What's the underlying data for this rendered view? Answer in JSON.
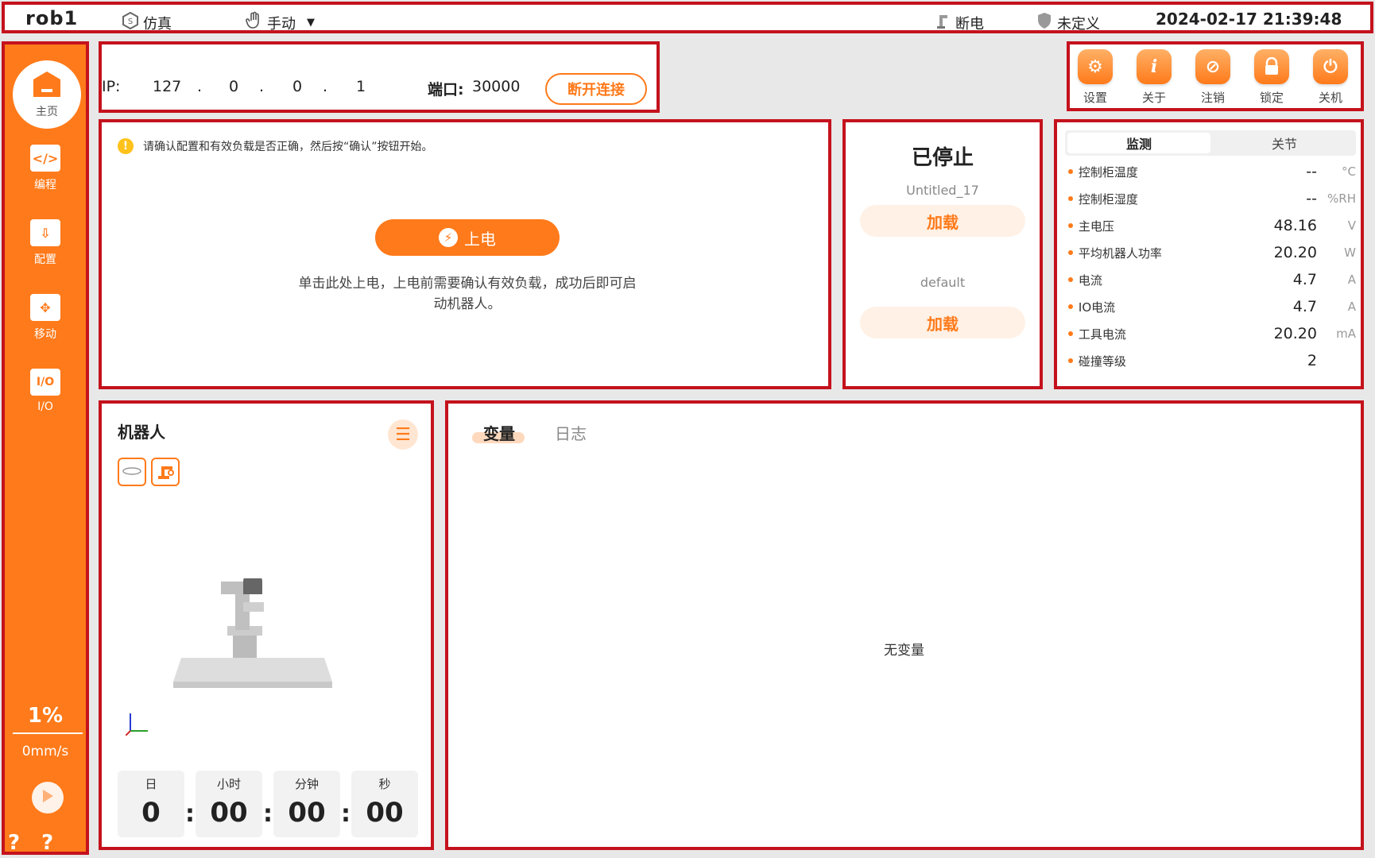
{
  "topbar": {
    "app_name": "rob1",
    "sim_label": "仿真",
    "mode_label": "手动",
    "power_status": "断电",
    "safety_status": "未定义",
    "datetime": "2024-02-17 21:39:48"
  },
  "sidebar": {
    "home_label": "主页",
    "items": [
      {
        "label": "编程",
        "icon": "code-icon"
      },
      {
        "label": "配置",
        "icon": "config-icon"
      },
      {
        "label": "移动",
        "icon": "move-icon"
      },
      {
        "label": "I/O",
        "icon": "io-icon"
      }
    ],
    "speed_percent": "1%",
    "speed_value": "0mm/s",
    "footer_text": "? ? ? ?"
  },
  "connection": {
    "ip_label": "IP:",
    "ip_parts": [
      "127",
      "0",
      "0",
      "1"
    ],
    "ip_dot": ".",
    "port_label": "端口:",
    "port_value": "30000",
    "disconnect_label": "断开连接"
  },
  "toolbar": {
    "settings": "设置",
    "about": "关于",
    "logout": "注销",
    "lock": "锁定",
    "shutdown": "关机"
  },
  "power": {
    "notice": "请确认配置和有效负载是否正确，然后按“确认”按钮开始。",
    "button_label": "上电",
    "description": "单击此处上电，上电前需要确认有效负载，成功后即可启动机器人。"
  },
  "program": {
    "state": "已停止",
    "program_name": "Untitled_17",
    "load_label_1": "加载",
    "config_name": "default",
    "load_label_2": "加载"
  },
  "monitor": {
    "tabs": [
      "监测",
      "关节"
    ],
    "rows": [
      {
        "label": "控制柜温度",
        "value": "--",
        "unit": "°C"
      },
      {
        "label": "控制柜湿度",
        "value": "--",
        "unit": "%RH"
      },
      {
        "label": "主电压",
        "value": "48.16",
        "unit": "V"
      },
      {
        "label": "平均机器人功率",
        "value": "20.20",
        "unit": "W"
      },
      {
        "label": "电流",
        "value": "4.7",
        "unit": "A"
      },
      {
        "label": "IO电流",
        "value": "4.7",
        "unit": "A"
      },
      {
        "label": "工具电流",
        "value": "20.20",
        "unit": "mA"
      },
      {
        "label": "碰撞等级",
        "value": "2",
        "unit": ""
      }
    ]
  },
  "robot": {
    "title": "机器人",
    "time_labels": [
      "日",
      "小时",
      "分钟",
      "秒"
    ],
    "time_values": [
      "0",
      "00",
      "00",
      "00"
    ],
    "separator": ":"
  },
  "variables": {
    "tab_vars": "变量",
    "tab_log": "日志",
    "empty_text": "无变量"
  },
  "colors": {
    "accent": "#ff7a1a",
    "frame": "#c4121d"
  }
}
